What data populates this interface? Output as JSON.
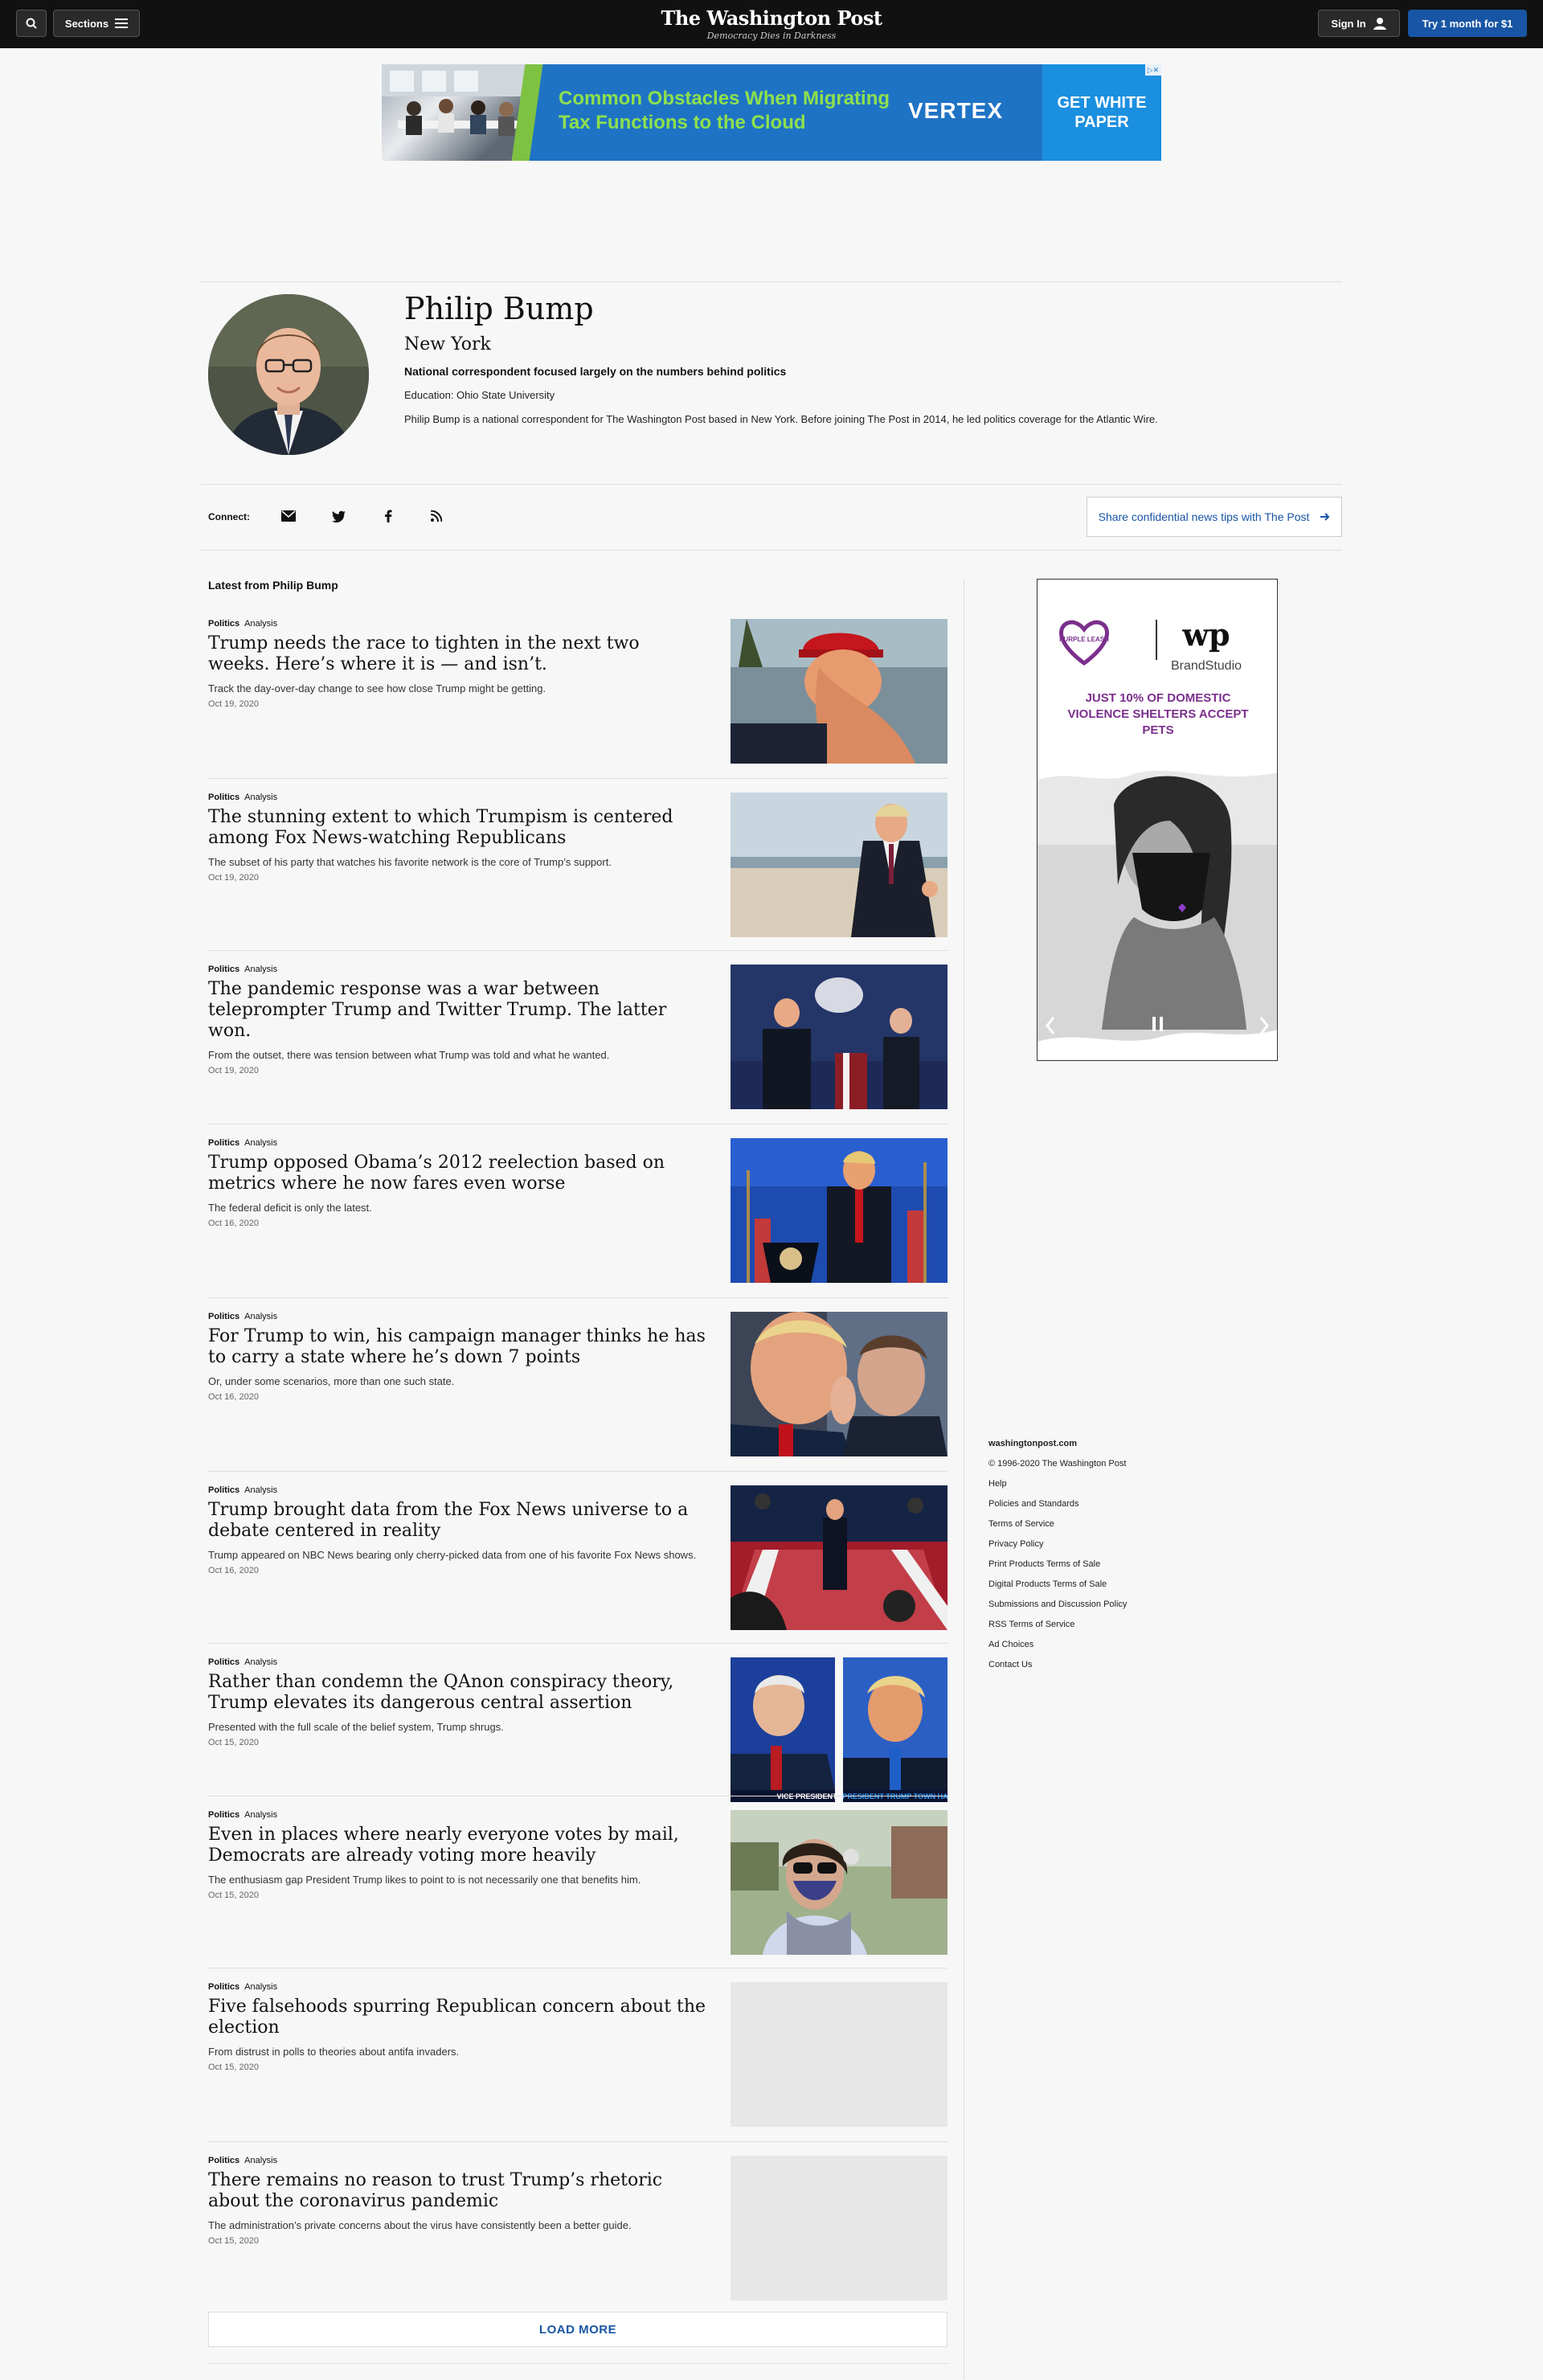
{
  "topbar": {
    "sections_label": "Sections",
    "masthead_logo": "The Washington Post",
    "masthead_tagline": "Democracy Dies in Darkness",
    "signin_label": "Sign In",
    "try_label": "Try 1 month for $1"
  },
  "ad_banner": {
    "headline": "Common Obstacles When Migrating Tax Functions to the Cloud",
    "brand": "VERTEX",
    "cta": "GET WHITE PAPER",
    "colors": {
      "background": "#1f73c5",
      "headline": "#8ee04d",
      "cta": "#1b8fe0"
    }
  },
  "author": {
    "name": "Philip Bump",
    "location": "New York",
    "role": "National correspondent focused largely on the numbers behind politics",
    "education": "Education: Ohio State University",
    "bio": "Philip Bump is a national correspondent for The Washington Post based in New York. Before joining The Post in 2014, he led politics coverage for the Atlantic Wire."
  },
  "connect": {
    "label": "Connect:",
    "icons": [
      "email-icon",
      "twitter-icon",
      "facebook-icon",
      "rss-icon"
    ],
    "tips_label": "Share confidential news tips with The Post"
  },
  "latest": {
    "heading": "Latest from Philip Bump",
    "stories": [
      {
        "section": "Politics",
        "label": "Analysis",
        "headline": "Trump needs the race to tighten in the next two weeks. Here’s where it is — and isn’t.",
        "blurb": "Track the day-over-day change to see how close Trump might be getting.",
        "date": "Oct 19, 2020",
        "thumb": "photo-red-cap"
      },
      {
        "section": "Politics",
        "label": "Analysis",
        "headline": "The stunning extent to which Trumpism is centered among Fox News-watching Republicans",
        "blurb": "The subset of his party that watches his favorite network is the core of Trump’s support.",
        "date": "Oct 19, 2020",
        "thumb": "photo-tarmac"
      },
      {
        "section": "Politics",
        "label": "Analysis",
        "headline": "The pandemic response was a war between teleprompter Trump and Twitter Trump. The latter won.",
        "blurb": "From the outset, there was tension between what Trump was told and what he wanted.",
        "date": "Oct 19, 2020",
        "thumb": "photo-briefing-room"
      },
      {
        "section": "Politics",
        "label": "Analysis",
        "headline": "Trump opposed Obama’s 2012 reelection based on metrics where he now fares even worse",
        "blurb": "The federal deficit is only the latest.",
        "date": "Oct 16, 2020",
        "thumb": "photo-podium"
      },
      {
        "section": "Politics",
        "label": "Analysis",
        "headline": "For Trump to win, his campaign manager thinks he has to carry a state where he’s down 7 points",
        "blurb": "Or, under some scenarios, more than one such state.",
        "date": "Oct 16, 2020",
        "thumb": "photo-closeup"
      },
      {
        "section": "Politics",
        "label": "Analysis",
        "headline": "Trump brought data from the Fox News universe to a debate centered in reality",
        "blurb": "Trump appeared on NBC News bearing only cherry-picked data from one of his favorite Fox News shows.",
        "date": "Oct 16, 2020",
        "thumb": "photo-town-hall"
      },
      {
        "section": "Politics",
        "label": "Analysis",
        "headline": "Rather than condemn the QAnon conspiracy theory, Trump elevates its dangerous central assertion",
        "blurb": "Presented with the full scale of the belief system, Trump shrugs.",
        "date": "Oct 15, 2020",
        "thumb": "photo-split-town-halls"
      },
      {
        "section": "Politics",
        "label": "Analysis",
        "headline": "Even in places where nearly everyone votes by mail, Democrats are already voting more heavily",
        "blurb": "The enthusiasm gap President Trump likes to point to is not necessarily one that benefits him.",
        "date": "Oct 15, 2020",
        "thumb": "photo-voter-mask"
      },
      {
        "section": "Politics",
        "label": "Analysis",
        "headline": "Five falsehoods spurring Republican concern about the election",
        "blurb": "From distrust in polls to theories about antifa invaders.",
        "date": "Oct 15, 2020",
        "thumb": "placeholder"
      },
      {
        "section": "Politics",
        "label": "Analysis",
        "headline": "There remains no reason to trust Trump’s rhetoric about the coronavirus pandemic",
        "blurb": "The administration’s private concerns about the virus have consistently been a better guide.",
        "date": "Oct 15, 2020",
        "thumb": "placeholder"
      }
    ],
    "load_more": "LOAD MORE",
    "split_captions": {
      "left": "VICE PRESIDENT",
      "right": "PRESIDENT TRUMP TOWN HA"
    }
  },
  "side_ad": {
    "sponsor": "PURPLE LEASH",
    "brand": "wp",
    "brand_sub": "BrandStudio",
    "message": "JUST 10% OF DOMESTIC VIOLENCE SHELTERS ACCEPT PETS"
  },
  "footer": {
    "site": "washingtonpost.com",
    "copyright": "© 1996-2020 The Washington Post",
    "links": [
      "Help",
      "Policies and Standards",
      "Terms of Service",
      "Privacy Policy",
      "Print Products Terms of Sale",
      "Digital Products Terms of Sale",
      "Submissions and Discussion Policy",
      "RSS Terms of Service",
      "Ad Choices",
      "Contact Us"
    ]
  }
}
